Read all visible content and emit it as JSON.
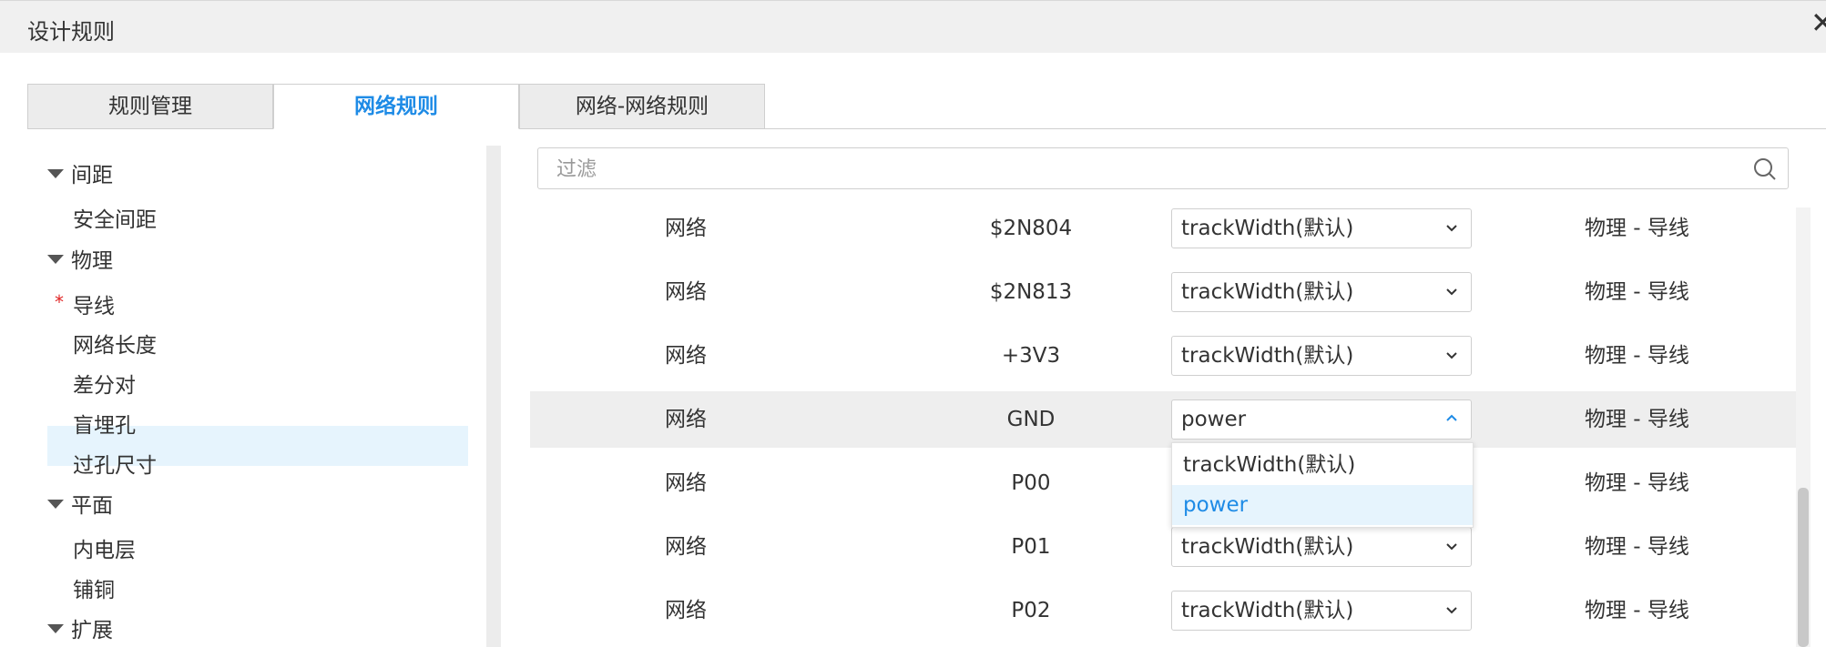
{
  "window": {
    "title": "设计规则",
    "close_glyph": "✕"
  },
  "tabs": [
    {
      "label": "规则管理",
      "active": false
    },
    {
      "label": "网络规则",
      "active": true
    },
    {
      "label": "网络-网络规则",
      "active": false
    }
  ],
  "tree": {
    "groups": [
      {
        "label": "间距",
        "items": [
          "安全间距"
        ]
      },
      {
        "label": "物理",
        "items": [
          "导线",
          "网络长度",
          "差分对",
          "盲埋孔",
          "过孔尺寸"
        ]
      },
      {
        "label": "平面",
        "items": [
          "内电层",
          "铺铜"
        ]
      },
      {
        "label": "扩展",
        "items": []
      }
    ],
    "selected_item": "导线",
    "modified_marker": "*"
  },
  "filter": {
    "placeholder": "过滤",
    "value": ""
  },
  "rows": [
    {
      "type": "网络",
      "net": "$2N804",
      "rule": "trackWidth(默认)",
      "category": "物理 - 导线",
      "open": false
    },
    {
      "type": "网络",
      "net": "$2N813",
      "rule": "trackWidth(默认)",
      "category": "物理 - 导线",
      "open": false
    },
    {
      "type": "网络",
      "net": "+3V3",
      "rule": "trackWidth(默认)",
      "category": "物理 - 导线",
      "open": false
    },
    {
      "type": "网络",
      "net": "GND",
      "rule": "power",
      "category": "物理 - 导线",
      "open": true
    },
    {
      "type": "网络",
      "net": "P00",
      "rule": "",
      "category": "物理 - 导线",
      "open": false
    },
    {
      "type": "网络",
      "net": "P01",
      "rule": "trackWidth(默认)",
      "category": "物理 - 导线",
      "open": false
    },
    {
      "type": "网络",
      "net": "P02",
      "rule": "trackWidth(默认)",
      "category": "物理 - 导线",
      "open": false
    }
  ],
  "dropdown": {
    "options": [
      "trackWidth(默认)",
      "power"
    ],
    "selected": "power"
  },
  "colors": {
    "accent": "#1e8be6",
    "selected_bg": "#e6f4fd",
    "row_highlight": "#eeeeee",
    "required_marker": "#e02424"
  },
  "icons": {
    "search": "search-icon",
    "chevron_down": "chevron-down-icon",
    "chevron_up": "chevron-up-icon",
    "expand": "triangle-down-icon",
    "close": "close-icon"
  }
}
